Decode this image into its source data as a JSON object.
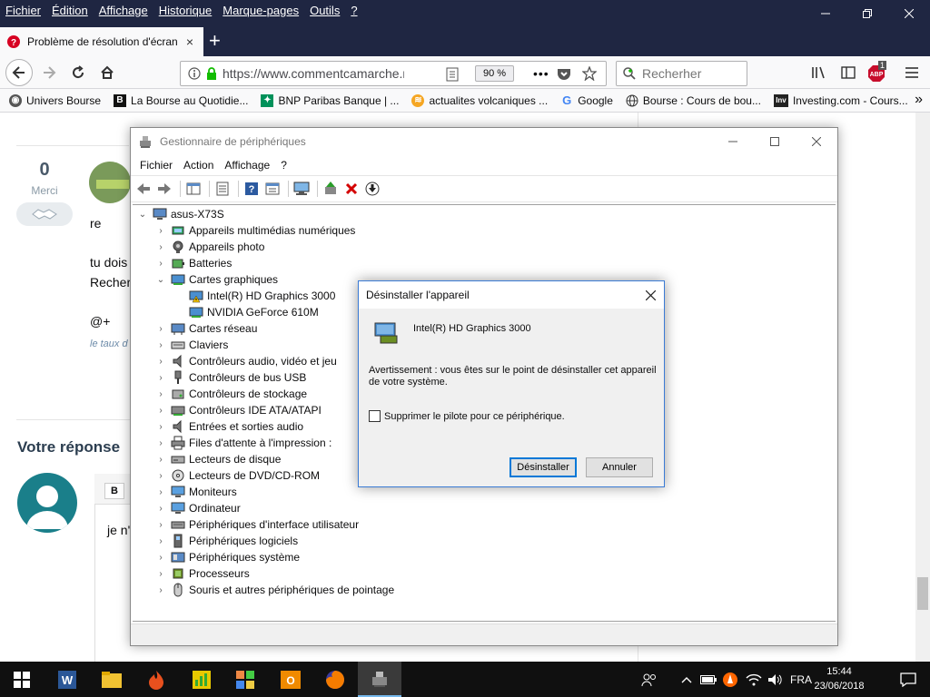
{
  "firefox": {
    "menu": [
      "Fichier",
      "Édition",
      "Affichage",
      "Historique",
      "Marque-pages",
      "Outils",
      "?"
    ],
    "tab": {
      "title": "Problème de résolution d'écran",
      "close": "×"
    },
    "newtab": "+",
    "url": "https://www.commentcamarche.n",
    "zoom": "90 %",
    "search_placeholder": "Recherher",
    "addon_badge": "1",
    "bookmarks": [
      "Univers Bourse",
      "La Bourse au Quotidie...",
      "BNP Paribas Banque | ...",
      "actualites volcaniques ...",
      "Google",
      "Bourse : Cours de bou...",
      "Investing.com - Cours..."
    ],
    "bookmark_more": "»"
  },
  "page": {
    "merci_count": "0",
    "merci_label": "Merci",
    "lines": [
      "re",
      "tu dois",
      "Recher",
      "@+",
      "le taux d"
    ],
    "votre_reponse": "Votre réponse",
    "editor_bold": "B",
    "editor_text": "je n'"
  },
  "devmgr": {
    "title": "Gestionnaire de périphériques",
    "menu": [
      "Fichier",
      "Action",
      "Affichage",
      "?"
    ],
    "root": "asus-X73S",
    "items": [
      "Appareils multimédias numériques",
      "Appareils photo",
      "Batteries",
      "Cartes graphiques",
      "Intel(R) HD Graphics 3000",
      "NVIDIA GeForce 610M",
      "Cartes réseau",
      "Claviers",
      "Contrôleurs audio, vidéo et jeu",
      "Contrôleurs de bus USB",
      "Contrôleurs de stockage",
      "Contrôleurs IDE ATA/ATAPI",
      "Entrées et sorties audio",
      "Files d'attente à l'impression :",
      "Lecteurs de disque",
      "Lecteurs de DVD/CD-ROM",
      "Moniteurs",
      "Ordinateur",
      "Périphériques d'interface utilisateur",
      "Périphériques logiciels",
      "Périphériques système",
      "Processeurs",
      "Souris et autres périphériques de pointage"
    ]
  },
  "dialog": {
    "title": "Désinstaller l'appareil",
    "device": "Intel(R) HD Graphics 3000",
    "warning": "Avertissement : vous êtes sur le point de désinstaller cet appareil de votre système.",
    "checkbox_label": "Supprimer le pilote pour ce périphérique.",
    "checkbox_checked": false,
    "uninstall": "Désinstaller",
    "cancel": "Annuler"
  },
  "taskbar": {
    "language": "FRA",
    "time": "15:44",
    "date": "23/06/2018"
  },
  "colors": {
    "titlebar": "#1f2642",
    "taskbar": "#101010",
    "accent": "#0078d7"
  }
}
